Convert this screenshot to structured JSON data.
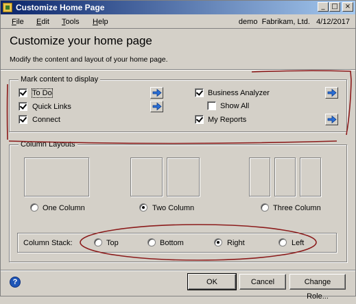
{
  "window": {
    "title": "Customize Home Page",
    "controls": {
      "minimize": "_",
      "maximize": "□",
      "close": "×"
    }
  },
  "menu": {
    "items": [
      {
        "label": "File",
        "mnemonic": "F"
      },
      {
        "label": "Edit",
        "mnemonic": "E"
      },
      {
        "label": "Tools",
        "mnemonic": "T"
      },
      {
        "label": "Help",
        "mnemonic": "H"
      }
    ],
    "user": "demo",
    "company": "Fabrikam, Ltd.",
    "date": "4/12/2017"
  },
  "header": {
    "title": "Customize your home page",
    "description": "Modify the content and layout of your home page."
  },
  "content_group": {
    "label": "Mark content to display",
    "items": [
      {
        "label": "To Do",
        "checked": true,
        "has_arrow": true,
        "focused": true
      },
      {
        "label": "Quick Links",
        "checked": true,
        "has_arrow": true
      },
      {
        "label": "Connect",
        "checked": true,
        "has_arrow": false
      },
      {
        "label": "Business Analyzer",
        "checked": true,
        "has_arrow": true
      },
      {
        "label": "Show All",
        "checked": false,
        "has_arrow": false
      },
      {
        "label": "My Reports",
        "checked": true,
        "has_arrow": true
      }
    ]
  },
  "layouts_group": {
    "label": "Column Layouts",
    "options": [
      {
        "label": "One Column",
        "selected": false
      },
      {
        "label": "Two Column",
        "selected": true
      },
      {
        "label": "Three Column",
        "selected": false
      }
    ],
    "stack_label": "Column Stack:",
    "stack_options": [
      {
        "label": "Top",
        "selected": false
      },
      {
        "label": "Bottom",
        "selected": false
      },
      {
        "label": "Right",
        "selected": true
      },
      {
        "label": "Left",
        "selected": false
      }
    ]
  },
  "footer": {
    "help_icon": "?",
    "ok": "OK",
    "cancel": "Cancel",
    "change_role": "Change Role..."
  },
  "colors": {
    "title_start": "#0a246a",
    "title_end": "#a6caf0",
    "annotation": "#8b1a1a",
    "arrow": "#2a6fd6"
  }
}
